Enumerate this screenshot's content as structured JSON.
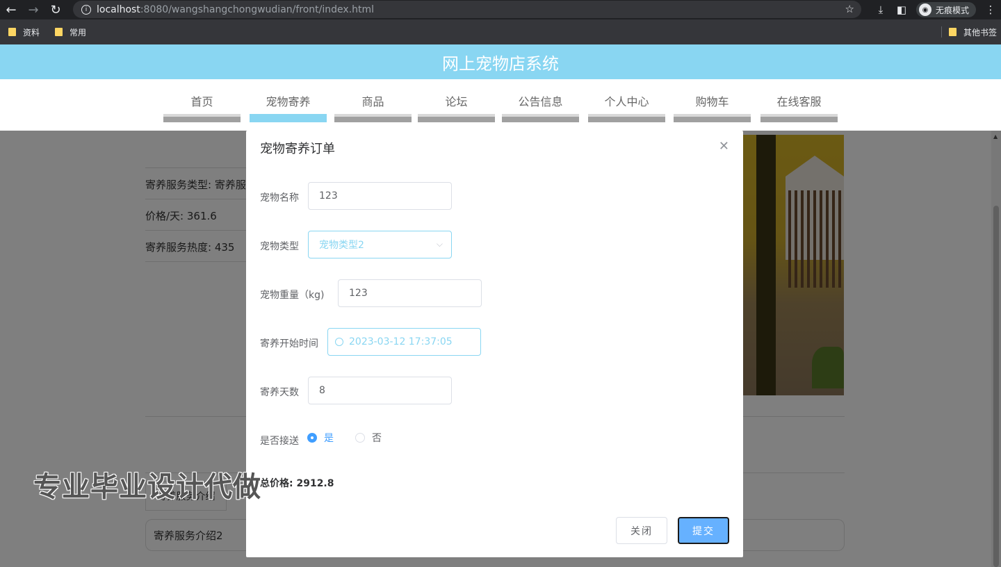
{
  "browser": {
    "url_host": "localhost",
    "url_path": ":8080/wangshangchongwudian/front/index.html",
    "incognito_label": "无痕模式",
    "bookmarks": [
      "资料",
      "常用"
    ],
    "other_bookmarks": "其他书签"
  },
  "site": {
    "title": "网上宠物店系统",
    "nav": [
      "首页",
      "宠物寄养",
      "商品",
      "论坛",
      "公告信息",
      "个人中心",
      "购物车",
      "在线客服"
    ],
    "active_nav": "宠物寄养"
  },
  "detail": {
    "service_type": "寄养服务类型: 寄养服",
    "price_per_day": "价格/天: 361.6",
    "popularity": "寄养服务热度: 435",
    "tab_label": "寄养服务介绍",
    "description": "寄养服务介绍2"
  },
  "dialog": {
    "title": "宠物寄养订单",
    "fields": {
      "pet_name_label": "宠物名称",
      "pet_name_value": "123",
      "pet_type_label": "宠物类型",
      "pet_type_value": "宠物类型2",
      "pet_weight_label": "宠物重量（kg)",
      "pet_weight_value": "123",
      "start_time_label": "寄养开始时间",
      "start_time_value": "2023-03-12 17:37:05",
      "days_label": "寄养天数",
      "days_value": "8",
      "pickup_label": "是否接送",
      "pickup_yes": "是",
      "pickup_no": "否"
    },
    "total_price": "总价格: 2912.8",
    "close_button": "关闭",
    "submit_button": "提交"
  },
  "watermark": "专业毕业设计代做",
  "colors": {
    "header": "#89d6f2",
    "primary": "#409eff",
    "submit": "#66b1ff"
  }
}
